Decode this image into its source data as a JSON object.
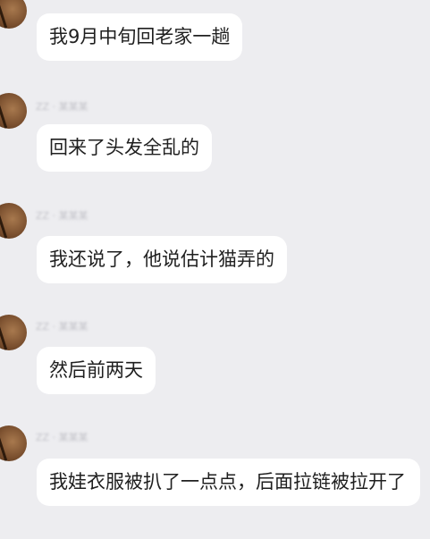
{
  "messages": [
    {
      "text": "我9月中旬回老家一趟"
    },
    {
      "sender": "ZZ · 某某某",
      "text": "回来了头发全乱的"
    },
    {
      "sender": "ZZ · 某某某",
      "text": "我还说了，他说估计猫弄的"
    },
    {
      "sender": "ZZ · 某某某",
      "text": "然后前两天"
    },
    {
      "sender": "ZZ · 某某某",
      "text": "我娃衣服被扒了一点点，后面拉链被拉开了"
    }
  ]
}
